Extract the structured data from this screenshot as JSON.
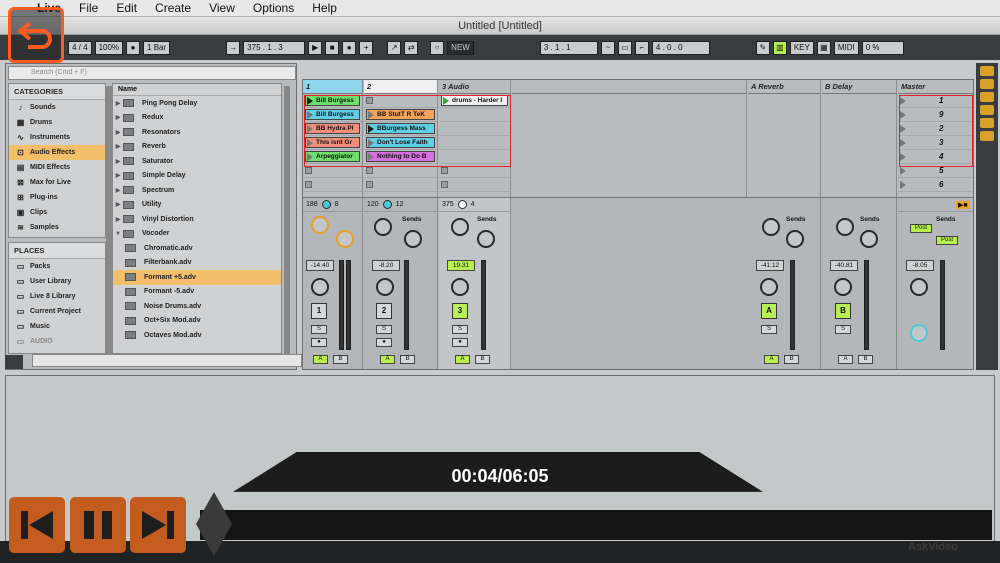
{
  "menubar": {
    "apple": "",
    "items": [
      "Live",
      "File",
      "Edit",
      "Create",
      "View",
      "Options",
      "Help"
    ]
  },
  "window": {
    "title": "Untitled  [Untitled]"
  },
  "transport": {
    "tempo_box": "4 / 4",
    "zoom": "100%",
    "quantize": "1 Bar",
    "position": "375 .  1 .  3",
    "new_label": "NEW",
    "loop_start": "3 .  1 .  1",
    "loop_len": "4 .  0 .  0",
    "key_label": "KEY",
    "midi_label": "MIDI",
    "cpu": "0 %"
  },
  "browser": {
    "search_placeholder": "Search (Cmd + F)",
    "categories_title": "CATEGORIES",
    "categories": [
      "Sounds",
      "Drums",
      "Instruments",
      "Audio Effects",
      "MIDI Effects",
      "Max for Live",
      "Plug-ins",
      "Clips",
      "Samples"
    ],
    "places_title": "PLACES",
    "places": [
      "Packs",
      "User Library",
      "Live 8 Library",
      "Current Project",
      "Music",
      "AUDIO"
    ],
    "name_header": "Name",
    "items": [
      "Ping Pong Delay",
      "Redux",
      "Resonators",
      "Reverb",
      "Saturator",
      "Simple Delay",
      "Spectrum",
      "Utility",
      "Vinyl Distortion",
      "Vocoder"
    ],
    "vocoder_presets": [
      "Chromatic.adv",
      "Filterbank.adv",
      "Formant +5.adv",
      "Formant -5.adv",
      "Noise Drums.adv",
      "Oct+Six Mod.adv",
      "Octaves Mod.adv"
    ]
  },
  "session": {
    "tracks": [
      {
        "name": "1",
        "clips": [
          "Bill Burgess",
          "Bill Burgess",
          "BB Hydra Pl",
          "This isnt Gr",
          "Arpeggiator"
        ],
        "colors": [
          "#6fe06a",
          "#5fd0e6",
          "#f28f7a",
          "#f28f7a",
          "#6fe06a"
        ],
        "vol": "-14.40",
        "in": "188",
        "in2": "8",
        "num": "1",
        "solo": "S"
      },
      {
        "name": "2",
        "clips": [
          "",
          "BB StutT R TeK",
          "BBurgess Mass",
          "Don't Lose Faith",
          "Nothing to Do B"
        ],
        "colors": [
          "",
          "#f5a356",
          "#5fd0e6",
          "#5fd0e6",
          "#d86fe0"
        ],
        "vol": "-8.20",
        "in": "120",
        "in2": "12",
        "num": "2",
        "solo": "S"
      },
      {
        "name": "3 Audio",
        "clips": [
          "drums - Harder I"
        ],
        "colors": [
          "#f0f0f0"
        ],
        "vol": "19.31",
        "in": "375",
        "in2": "4",
        "num": "3",
        "solo": "S"
      }
    ],
    "returns": [
      {
        "name": "A Reverb",
        "vol": "-41.12",
        "letter": "A",
        "solo": "S"
      },
      {
        "name": "B Delay",
        "vol": "-40.81",
        "letter": "B",
        "solo": "S"
      }
    ],
    "master": {
      "name": "Master",
      "scenes": [
        "1",
        "9",
        "2",
        "3",
        "4",
        "5",
        "6"
      ],
      "vol": "-8.05"
    },
    "sends_label": "Sends",
    "send_a": "A",
    "send_b": "B",
    "post_label": "Post",
    "scale": [
      "6",
      "0",
      "6",
      "12",
      "24",
      "36",
      "60"
    ]
  },
  "player": {
    "timecode": "00:04/06:05",
    "watermark": "AskVideo"
  },
  "colors": {
    "accent": "#ff5a1f",
    "clip_green": "#b8f04f",
    "selection": "#f3bf6b"
  }
}
